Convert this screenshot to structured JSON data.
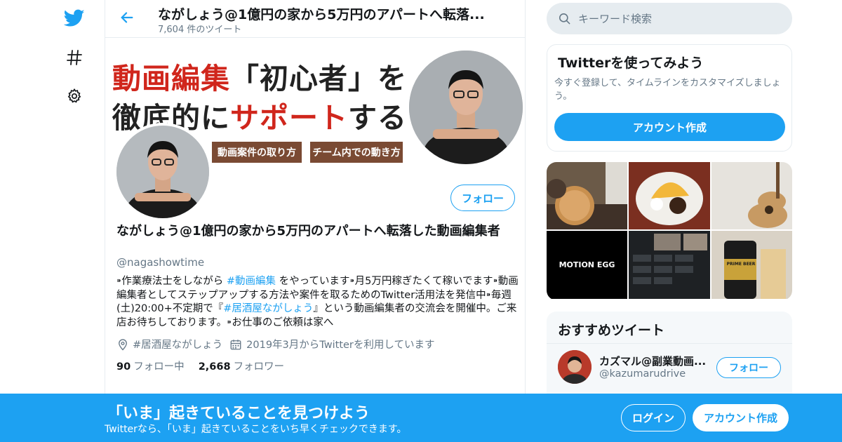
{
  "colors": {
    "accent": "#1da1f2",
    "text": "#14171a",
    "muted": "#657786",
    "border": "#e6ecf0",
    "banner_red": "#d0261c",
    "banner_brown": "#7a4a33"
  },
  "nav": {
    "icons": [
      "twitter-bird-icon",
      "hashtag-icon",
      "gear-icon"
    ]
  },
  "header": {
    "title": "ながしょう@1億円の家から5万円のアパートへ転落...",
    "tweet_count": "7,604 件のツイート"
  },
  "banner": {
    "line1_red": "動画編集",
    "line1_black": "「初心者」を",
    "line2_black_a": "徹底的に",
    "line2_red": "サポート",
    "line2_black_b": "する",
    "tag1": "動画案件の取り方",
    "tag2": "チーム内での動き方"
  },
  "profile": {
    "follow_label": "フォロー",
    "display_name": "ながしょう@1億円の家から5万円のアパートへ転落した動画編集者",
    "handle": "@nagashowtime",
    "bio": {
      "p1": "⁍作業療法士をしながら ",
      "p1_link": "#動画編集",
      "p2": " をやっています⁍月5万円稼ぎたくて稼いでます⁍動画編集者としてステップアップする方法や案件を取るためのTwitter活用法を発信中⁍毎週(土)20:00+不定期で『",
      "p2_link": "#居酒屋ながしょう",
      "p3": "』という動画編集者の交流会を開催中。ご来店お待ちしております。⁍お仕事のご依頼は家へ"
    },
    "location": "#居酒屋ながしょう",
    "joined": "2019年3月からTwitterを利用しています",
    "following_count": "90",
    "following_label": "フォロー中",
    "followers_count": "2,668",
    "followers_label": "フォロワー"
  },
  "search": {
    "placeholder": "キーワード検索"
  },
  "signup_card": {
    "title": "Twitterを使ってみよう",
    "description": "今すぐ登録して、タイムラインをカスタマイズしましょう。",
    "button": "アカウント作成"
  },
  "media": {
    "motion_egg": "MOTION EGG",
    "beer_label": "PRIME BEER"
  },
  "recommend": {
    "title": "おすすめツイート",
    "user_name": "カズマル@副業動画...",
    "user_handle": "@kazumarudrive",
    "follow_label": "フォロー"
  },
  "bottom_bar": {
    "title": "「いま」起きていることを見つけよう",
    "subtitle": "Twitterなら、「いま」起きていることをいち早くチェックできます。",
    "login": "ログイン",
    "signup": "アカウント作成"
  }
}
